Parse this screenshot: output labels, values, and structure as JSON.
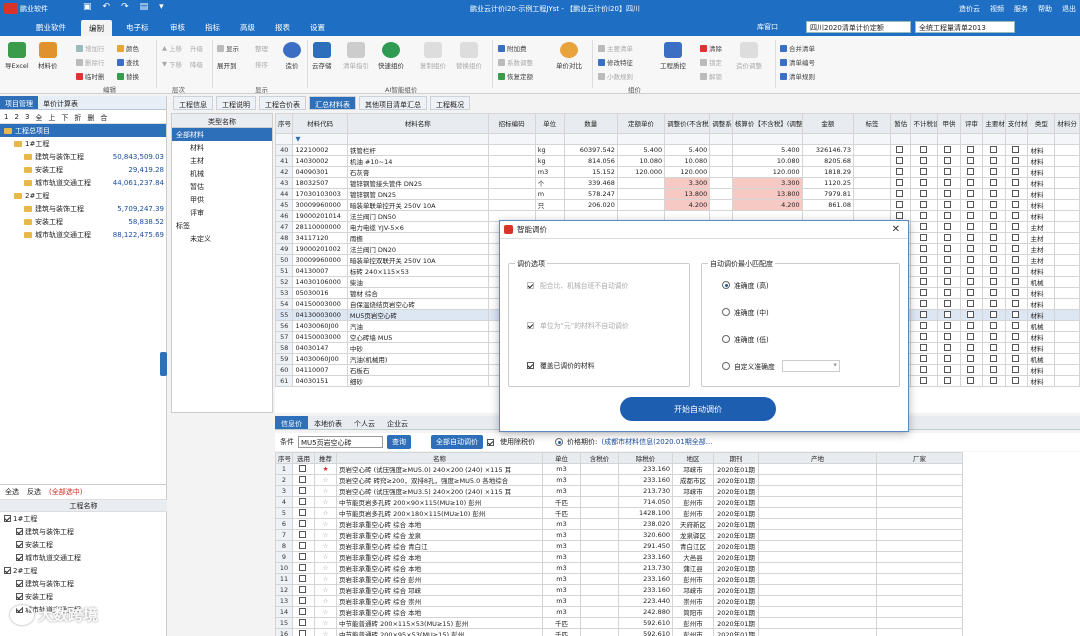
{
  "title": "鹏业云计价i20-示例工程JYst - 【鹏业云计价i20】四川",
  "logo": "鹏业软件",
  "titlebar_right": [
    "造价云",
    "视频",
    "服务",
    "帮助",
    "退出"
  ],
  "menu": {
    "file": "鹏业软件",
    "items": [
      "编制",
      "电子标",
      "审核",
      "指标",
      "高级",
      "报表",
      "设置"
    ],
    "active": "编制",
    "window": "库窗口",
    "quota": "四川2020清单计价定额",
    "spec": "全统工程量清单2013"
  },
  "ribbon": {
    "excel": "导Excel",
    "material": "材料价",
    "small": [
      "增加行",
      "删除行",
      "临时删",
      "颜色",
      "查找",
      "替换",
      "上移",
      "下移",
      "升级",
      "降级",
      "显示",
      "展开到",
      "整理",
      "排序",
      "造价"
    ],
    "cloud": "云存储",
    "clear": "清单指引",
    "quick": "快速组价",
    "copy": "复制组价",
    "replace": "替换组价",
    "attach": "附加费",
    "ratio": "系数调整",
    "restore": "恢复定额",
    "unit_compare": "单价对比",
    "main_mat": "主要清单",
    "modify": "修改特征",
    "small_digit": "小数规则",
    "qc": "工程质控",
    "clear2": "清除",
    "lock": "锁定",
    "unlock": "解锁",
    "adjust": "造价调整",
    "merge": "合并清单",
    "code": "清单编号",
    "rule": "清单规则",
    "groups": [
      "编辑",
      "层次",
      "显示",
      "AI智能组价",
      "组价"
    ]
  },
  "left": {
    "tabs": [
      "项目管理",
      "单价计算表"
    ],
    "tools": [
      "1",
      "2",
      "3",
      "全",
      "上",
      "下",
      "折",
      "删",
      "合"
    ],
    "tree": [
      {
        "name": "工程总项目",
        "level": 0,
        "sel": true,
        "val": ""
      },
      {
        "name": "1#工程",
        "level": 1,
        "val": ""
      },
      {
        "name": "建筑与装饰工程",
        "level": 2,
        "val": "50,843,509.03"
      },
      {
        "name": "安装工程",
        "level": 2,
        "val": "29,419.28"
      },
      {
        "name": "城市轨道交通工程",
        "level": 2,
        "val": "44,061,237.84"
      },
      {
        "name": "2#工程",
        "level": 1,
        "val": ""
      },
      {
        "name": "建筑与装饰工程",
        "level": 2,
        "val": "5,709,247.39"
      },
      {
        "name": "安装工程",
        "level": 2,
        "val": "58,838.52"
      },
      {
        "name": "城市轨道交通工程",
        "level": 2,
        "val": "88,122,475.69"
      }
    ],
    "sel_all": "全选",
    "inverse": "反选",
    "all_sel": "(全部选中)",
    "proj_name": "工程名称",
    "ctree": [
      {
        "name": "1#工程",
        "level": 0
      },
      {
        "name": "建筑与装饰工程",
        "level": 1
      },
      {
        "name": "安装工程",
        "level": 1
      },
      {
        "name": "城市轨道交通工程",
        "level": 1
      },
      {
        "name": "2#工程",
        "level": 0
      },
      {
        "name": "建筑与装饰工程",
        "level": 1
      },
      {
        "name": "安装工程",
        "level": 1
      },
      {
        "name": "城市轨道交通工程",
        "level": 1
      }
    ]
  },
  "doctabs": [
    "工程信息",
    "工程说明",
    "工程合价表",
    "汇总材料表",
    "其他项目清单汇总",
    "工程概况"
  ],
  "doctab_active": "汇总材料表",
  "cats": {
    "header": "类型名称",
    "items": [
      "全部材料",
      "材料",
      "主材",
      "机械",
      "暂估",
      "甲供",
      "评审",
      "标签",
      "未定义"
    ]
  },
  "grid": {
    "headers": [
      "序号",
      "材料代码",
      "材料名称",
      "招标编码",
      "单位",
      "数量",
      "定额单价",
      "调整价(不含税)",
      "调整系数",
      "核算价【不含税】(调整价×调整系数)",
      "金额",
      "标签",
      "暂估",
      "不计税设备",
      "甲供",
      "评审",
      "主要材料",
      "支付材料",
      "类型",
      "材料分"
    ],
    "rows": [
      [
        "40",
        "12210002",
        "铁管栏杆",
        "",
        "kg",
        "60397.542",
        "5.400",
        "5.400",
        "",
        "5.400",
        "326146.73",
        "材料"
      ],
      [
        "41",
        "14030002",
        "机油 #10~14",
        "",
        "kg",
        "814.056",
        "10.080",
        "10.080",
        "",
        "10.080",
        "8205.68",
        "材料"
      ],
      [
        "42",
        "04090301",
        "石灰膏",
        "",
        "m3",
        "15.152",
        "120.000",
        "120.000",
        "",
        "120.000",
        "1818.29",
        "材料"
      ],
      [
        "43",
        "18032507",
        "镀锌钢管接头管件 DN25",
        "",
        "个",
        "339.468",
        "",
        "3.300",
        "",
        "3.300",
        "1120.25",
        "材料"
      ],
      [
        "44",
        "17030103003",
        "镀锌钢管 DN25",
        "",
        "m",
        "578.247",
        "",
        "13.800",
        "",
        "13.800",
        "7979.81",
        "材料"
      ],
      [
        "45",
        "30009960000",
        "暗装单联单控开关 250V 10A",
        "",
        "只",
        "206.020",
        "",
        "4.200",
        "",
        "4.200",
        "861.08",
        "材料"
      ],
      [
        "46",
        "19000201014",
        "法兰阀门 DN50",
        "",
        "",
        "",
        "",
        "",
        "",
        "",
        "",
        "材料"
      ],
      [
        "47",
        "28110000000",
        "电力电缆 YJV-5×6",
        "",
        "",
        "",
        "",
        "",
        "",
        "",
        "",
        "主材"
      ],
      [
        "48",
        "34117120",
        "雨檐",
        "",
        "",
        "",
        "",
        "",
        "",
        "",
        "",
        "主材"
      ],
      [
        "49",
        "19000201002",
        "法兰阀门 DN20",
        "",
        "",
        "",
        "",
        "",
        "",
        "",
        "",
        "主材"
      ],
      [
        "50",
        "30009960000",
        "暗装单控双联开关 250V 10A",
        "",
        "",
        "",
        "",
        "",
        "",
        "",
        "",
        "主材"
      ],
      [
        "51",
        "04130007",
        "标砖 240×115×53",
        "",
        "",
        "",
        "",
        "",
        "",
        "",
        "",
        "材料"
      ],
      [
        "52",
        "14030106000",
        "柴油",
        "",
        "",
        "",
        "",
        "",
        "",
        "",
        "",
        "机械"
      ],
      [
        "53",
        "05030016",
        "镀材 综合",
        "",
        "",
        "",
        "",
        "",
        "",
        "",
        "",
        "材料"
      ],
      [
        "54",
        "04150003000",
        "自保温烧结页岩空心砖",
        "",
        "",
        "",
        "",
        "",
        "",
        "",
        "",
        "材料"
      ],
      [
        "55",
        "04130003000",
        "MU5页岩空心砖",
        "",
        "",
        "",
        "",
        "",
        "",
        "",
        "",
        "材料"
      ],
      [
        "56",
        "14030060J00",
        "汽油",
        "",
        "",
        "",
        "",
        "",
        "",
        "",
        "",
        "机械"
      ],
      [
        "57",
        "04150003000",
        "空心砖墙 MU5",
        "",
        "",
        "",
        "",
        "",
        "",
        "",
        "",
        "材料"
      ],
      [
        "58",
        "04030147",
        "中砂",
        "",
        "",
        "",
        "",
        "",
        "",
        "",
        "",
        "材料"
      ],
      [
        "59",
        "14030060J00",
        "汽油(机械用)",
        "",
        "",
        "",
        "",
        "",
        "",
        "",
        "",
        "机械"
      ],
      [
        "60",
        "04110007",
        "石板石",
        "",
        "",
        "",
        "",
        "",
        "",
        "",
        "",
        "材料"
      ],
      [
        "61",
        "04030151",
        "细砂",
        "",
        "",
        "",
        "",
        "",
        "",
        "",
        "",
        "材料"
      ]
    ],
    "pink_rows": [
      "43",
      "44",
      "45"
    ],
    "bold_row": "55"
  },
  "bottom": {
    "tabs": [
      "信息价",
      "本地价表",
      "个人云",
      "企业云"
    ],
    "cond_label": "条件",
    "cond_value": "MU5页岩空心砖",
    "query": "查询",
    "auto": "全部自动调价",
    "use_tax": "使用除税价",
    "price_period": "价格期价:",
    "price_src": "(成都市材料信息(2020.01期全部...",
    "headers": [
      "序号",
      "选用",
      "推荐",
      "名称",
      "单位",
      "含税价",
      "除税价",
      "地区",
      "期刊",
      "产地",
      "厂家"
    ],
    "rows": [
      [
        "1",
        "页岩空心砖 (试压强度≥MU5.0) 240×200 (240) ×115 耳",
        "m3",
        "",
        "233.160",
        "邛崃市",
        "2020年01期"
      ],
      [
        "2",
        "页岩空心砖 砖窍≥200，双排8孔，强度≥MU5.0 各地综合",
        "m3",
        "",
        "233.160",
        "成都市区",
        "2020年01期"
      ],
      [
        "3",
        "页岩空心砖 (试压强度≥MU3.5) 240×200 (240) ×115 耳",
        "m3",
        "",
        "213.730",
        "邛崃市",
        "2020年01期"
      ],
      [
        "4",
        "中节能页岩多孔砖 200×90×115(MU≥10) 彭州",
        "千匹",
        "",
        "714.050",
        "彭州市",
        "2020年01期"
      ],
      [
        "5",
        "中节能页岩多孔砖 200×180×115(MU≥10) 彭州",
        "千匹",
        "",
        "1428.100",
        "彭州市",
        "2020年01期"
      ],
      [
        "6",
        "页岩非承重空心砖 综合 本地",
        "m3",
        "",
        "238.020",
        "天府新区",
        "2020年01期"
      ],
      [
        "7",
        "页岩非承重空心砖 综合 龙泉",
        "m3",
        "",
        "320.600",
        "龙泉驿区",
        "2020年01期"
      ],
      [
        "8",
        "页岩非承重空心砖 综合 青白江",
        "m3",
        "",
        "291.450",
        "青白江区",
        "2020年01期"
      ],
      [
        "9",
        "页岩非承重空心砖 综合 本地",
        "m3",
        "",
        "233.160",
        "大邑县",
        "2020年01期"
      ],
      [
        "10",
        "页岩非承重空心砖 综合 本地",
        "m3",
        "",
        "213.730",
        "蒲江县",
        "2020年01期"
      ],
      [
        "11",
        "页岩非承重空心砖 综合 彭州",
        "m3",
        "",
        "233.160",
        "彭州市",
        "2020年01期"
      ],
      [
        "12",
        "页岩非承重空心砖 综合 邛崃",
        "m3",
        "",
        "233.160",
        "邛崃市",
        "2020年01期"
      ],
      [
        "13",
        "页岩非承重空心砖 综合 崇州",
        "m3",
        "",
        "223.440",
        "崇州市",
        "2020年01期"
      ],
      [
        "14",
        "页岩非承重空心砖 综合 本地",
        "m3",
        "",
        "242.880",
        "简阳市",
        "2020年01期"
      ],
      [
        "15",
        "中节能普通砖 200×115×53(MU≥15) 彭州",
        "千匹",
        "",
        "592.610",
        "彭州市",
        "2020年01期"
      ],
      [
        "16",
        "中节能普通砖 200×95×53(MU≥15) 彭州",
        "千匹",
        "",
        "592.610",
        "彭州市",
        "2020年01期"
      ]
    ]
  },
  "dialog": {
    "title": "智能调价",
    "left_group": "调价选项",
    "opts": [
      "配合比、机械台班不自动调价",
      "单位为“元”的材料不自动调价",
      "覆盖已调价的材料"
    ],
    "right_group": "自动调价最小匹配度",
    "radios": [
      "准确度 (高)",
      "准确度 (中)",
      "准确度 (低)",
      "自定义准确度"
    ],
    "start": "开始自动调价"
  },
  "watermark": "大数跨境",
  "colors": {
    "brand": "#1e6fc4",
    "accent": "#2d6fb8",
    "pink": "#f7c9c4"
  }
}
